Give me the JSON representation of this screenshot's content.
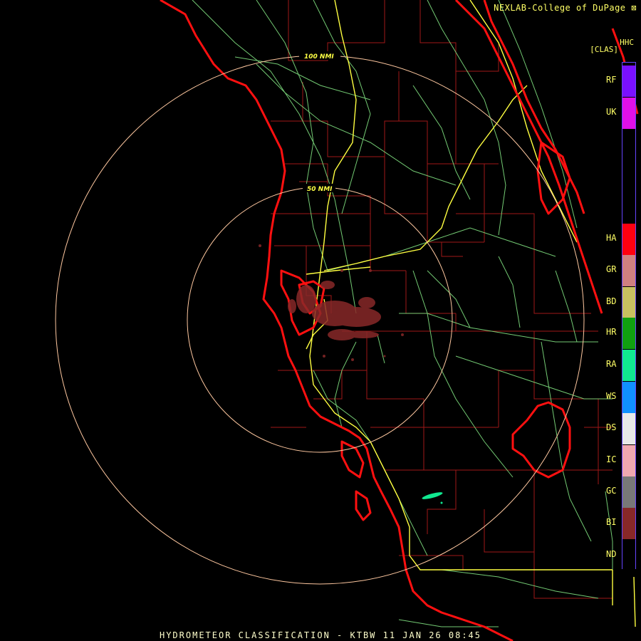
{
  "credit": "NEXLAB-College of DuPage",
  "legend": {
    "title": "HHC",
    "subtitle": "[CLAS]",
    "classes": [
      {
        "code": "RF",
        "color": "#7a10ff"
      },
      {
        "code": "UK",
        "color": "#e010e8"
      },
      {
        "code": "HA",
        "color": "#ff0010"
      },
      {
        "code": "GR",
        "color": "#d08080"
      },
      {
        "code": "BD",
        "color": "#c8c060"
      },
      {
        "code": "HR",
        "color": "#10a010"
      },
      {
        "code": "RA",
        "color": "#10e890"
      },
      {
        "code": "WS",
        "color": "#1090ff"
      },
      {
        "code": "DS",
        "color": "#e8e8e8"
      },
      {
        "code": "IC",
        "color": "#f0a8b0"
      },
      {
        "code": "GC",
        "color": "#787878"
      },
      {
        "code": "BI",
        "color": "#882828"
      },
      {
        "code": "ND",
        "color": "#000000"
      }
    ]
  },
  "range_rings": [
    {
      "label": "100 NMI"
    },
    {
      "label": "50 NMI"
    }
  ],
  "footer": "HYDROMETEOR CLASSIFICATION - KTBW 11 JAN 26 08:45",
  "colors": {
    "coastline": "#ff1010",
    "county": "#a01818",
    "highway": "#ffff40",
    "road": "#80e080",
    "ring": "#ffc8a0",
    "echo_bi": "#882828",
    "echo_ra": "#10e890"
  }
}
